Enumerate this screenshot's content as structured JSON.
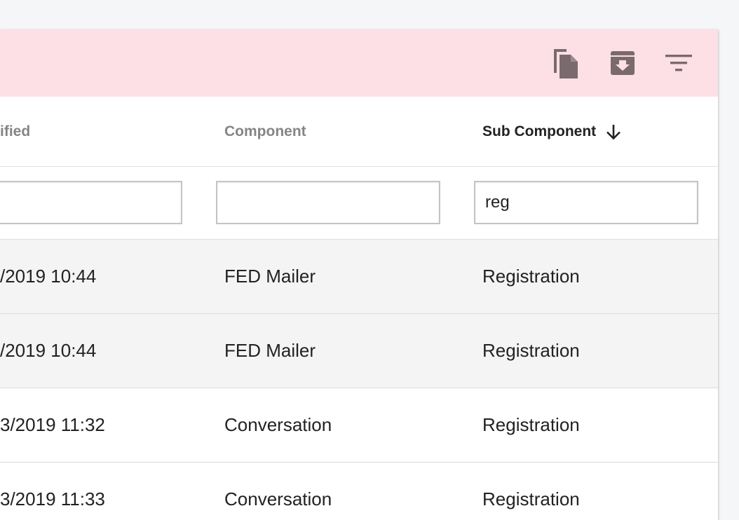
{
  "toolbar": {
    "icons": [
      "copy-icon",
      "archive-download-icon",
      "filter-icon"
    ]
  },
  "columns": {
    "modified": "ified",
    "component": "Component",
    "sub_component": "Sub Component"
  },
  "filters": {
    "modified": "",
    "component": "",
    "sub_component": "reg"
  },
  "rows": [
    {
      "modified": "/2019 10:44",
      "component": "FED Mailer",
      "sub_component": "Registration"
    },
    {
      "modified": "/2019 10:44",
      "component": "FED Mailer",
      "sub_component": "Registration"
    },
    {
      "modified": "3/2019 11:32",
      "component": "Conversation",
      "sub_component": "Registration"
    },
    {
      "modified": "3/2019 11:33",
      "component": "Conversation",
      "sub_component": "Registration"
    }
  ],
  "colors": {
    "toolbar_bg": "#fde0e6",
    "icon": "#7a6a6e",
    "shaded_row": "#f4f4f4"
  }
}
